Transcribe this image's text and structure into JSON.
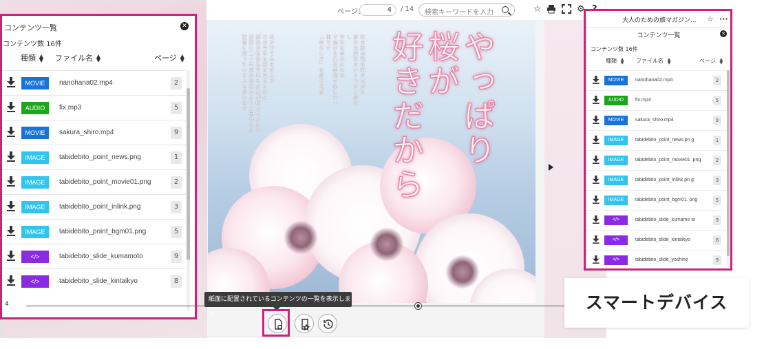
{
  "toolbar": {
    "page_label": "ページ：",
    "current_page": "4",
    "total_pages": "/ 14",
    "search_placeholder": "検索キーワードを入力",
    "icons": [
      "search-icon",
      "star-icon",
      "print-icon",
      "fullscreen-icon",
      "gear-icon",
      "help-icon"
    ]
  },
  "magazine": {
    "title": "やっぱり桜が好きだから",
    "title_lines": [
      "やっぱり",
      "桜が",
      "好きだから"
    ],
    "body_columns": [
      "記憶に残っている人も多いはず",
      "恋桜に二十年目の出来のように思われた",
      "桜色の散歩は今年もお花が咲いています",
      "さあ今年も桜を見るために",
      "出かけてみませんか"
    ],
    "body_columns_2": [
      "「春らしさ」を感じる旅",
      "で始まる花の季節を楽しむ一冊です",
      "今年も春のための",
      "旅の方向性をいくつかご紹介し",
      "紅白歌合戦を聞きながら"
    ]
  },
  "left_panel": {
    "title": "コンテンツ一覧",
    "count_text": "コンテンツ数  16件",
    "headers": {
      "type": "種類",
      "filename": "ファイル名",
      "page": "ページ"
    },
    "rows": [
      {
        "type": "MOVIE",
        "color": "#1a73d9",
        "name": "nanohana02.mp4",
        "page": "2"
      },
      {
        "type": "AUDIO",
        "color": "#1aa81a",
        "name": "fix.mp3",
        "page": "5"
      },
      {
        "type": "MOVIE",
        "color": "#1a73d9",
        "name": "sakura_shiro.mp4",
        "page": "9"
      },
      {
        "type": "IMAGE",
        "color": "#33c4ee",
        "name": "tabidebito_point_news.png",
        "page": "1"
      },
      {
        "type": "IMAGE",
        "color": "#33c4ee",
        "name": "tabidebito_point_movie01.png",
        "page": "2"
      },
      {
        "type": "IMAGE",
        "color": "#33c4ee",
        "name": "tabidebito_point_inlink.png",
        "page": "3"
      },
      {
        "type": "IMAGE",
        "color": "#33c4ee",
        "name": "tabidebito_point_bgm01.png",
        "page": "5"
      },
      {
        "type": "</>",
        "color": "#8a2be2",
        "name": "tabidebito_slide_kumamoto",
        "page": "9"
      },
      {
        "type": "</>",
        "color": "#8a2be2",
        "name": "tabidebito_slide_kintaikyo",
        "page": "8"
      }
    ]
  },
  "slider": {
    "value_label": "4",
    "position": 0.73
  },
  "tooltip": "紙面に配置されているコンテンツの一覧を表示します",
  "bottom_buttons": [
    "content-list-icon",
    "bookmark-list-icon",
    "history-icon"
  ],
  "phone": {
    "title": "大人のための旅マガジン...",
    "subtitle": "コンテンツ一覧",
    "count_text": "コンテンツ数  16件",
    "headers": {
      "type": "種類",
      "filename": "ファイル名",
      "page": "ページ"
    },
    "rows": [
      {
        "type": "MOVIE",
        "color": "#1a73d9",
        "name": "nanohana02.mp4",
        "page": "2"
      },
      {
        "type": "AUDIO",
        "color": "#1aa81a",
        "name": "fix.mp3",
        "page": "5"
      },
      {
        "type": "MOVIE",
        "color": "#1a73d9",
        "name": "sakura_shiro.mp4",
        "page": "9"
      },
      {
        "type": "IMAGE",
        "color": "#33c4ee",
        "name": "tabidebito_point_news.pn g",
        "page": "1"
      },
      {
        "type": "IMAGE",
        "color": "#33c4ee",
        "name": "tabidebito_point_movie01 .png",
        "page": "2"
      },
      {
        "type": "IMAGE",
        "color": "#33c4ee",
        "name": "tabidebito_point_inlink.pn g",
        "page": "3"
      },
      {
        "type": "IMAGE",
        "color": "#33c4ee",
        "name": "tabidebito_point_bgm01. png",
        "page": "5"
      },
      {
        "type": "</>",
        "color": "#8a2be2",
        "name": "tabidebito_slide_kumamo to",
        "page": "9"
      },
      {
        "type": "</>",
        "color": "#8a2be2",
        "name": "tabidebito_slide_kintaikyo",
        "page": "8"
      },
      {
        "type": "</>",
        "color": "#8a2be2",
        "name": "tabidebito_slide_yoshino",
        "page": "9"
      }
    ]
  },
  "smart_device_label": "スマートデバイス",
  "highlight_color": "#d1207a"
}
